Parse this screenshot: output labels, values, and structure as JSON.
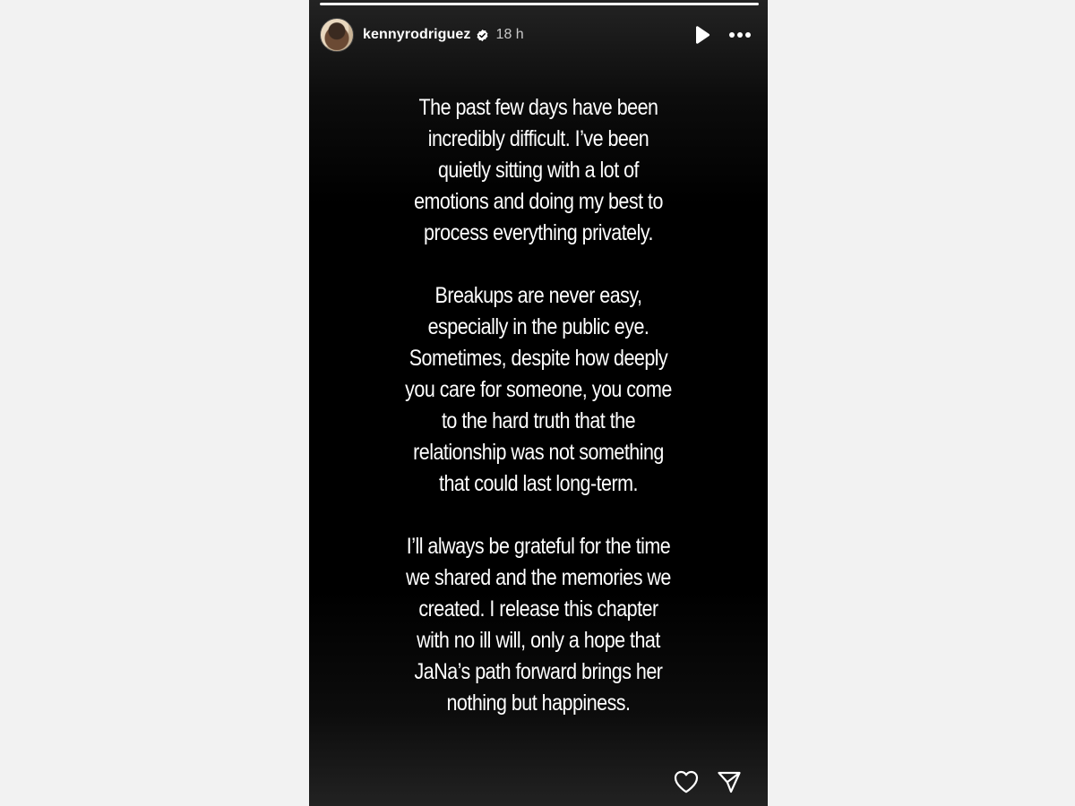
{
  "story": {
    "progress": 1.0,
    "user": {
      "username": "kennyrodriguez",
      "verified": true,
      "time_ago": "18 h",
      "avatar_icon": "avatar"
    },
    "controls": {
      "play_icon": "play-icon",
      "more_icon": "more-options-icon"
    },
    "paragraphs": [
      {
        "lines": [
          "The past few days have been",
          "incredibly difficult. I’ve been",
          "quietly sitting with a lot of",
          "emotions and doing my best to",
          "process everything privately."
        ]
      },
      {
        "lines": [
          "Breakups are never easy,",
          "especially in the public eye.",
          "Sometimes, despite how deeply",
          "you care for someone, you come",
          "to the hard truth that the",
          "relationship was not something",
          "that could last long-term."
        ]
      },
      {
        "lines": [
          "I’ll always be grateful for the time",
          "we shared and the memories we",
          "created. I release this chapter",
          "with no ill will, only a hope that",
          "JaNa’s path forward brings her",
          "nothing but happiness."
        ]
      }
    ],
    "actions": {
      "like_icon": "heart-icon",
      "share_icon": "send-icon"
    },
    "colors": {
      "background": "#000000",
      "text": "#ffffff",
      "verified_badge": "#ffffff"
    }
  }
}
